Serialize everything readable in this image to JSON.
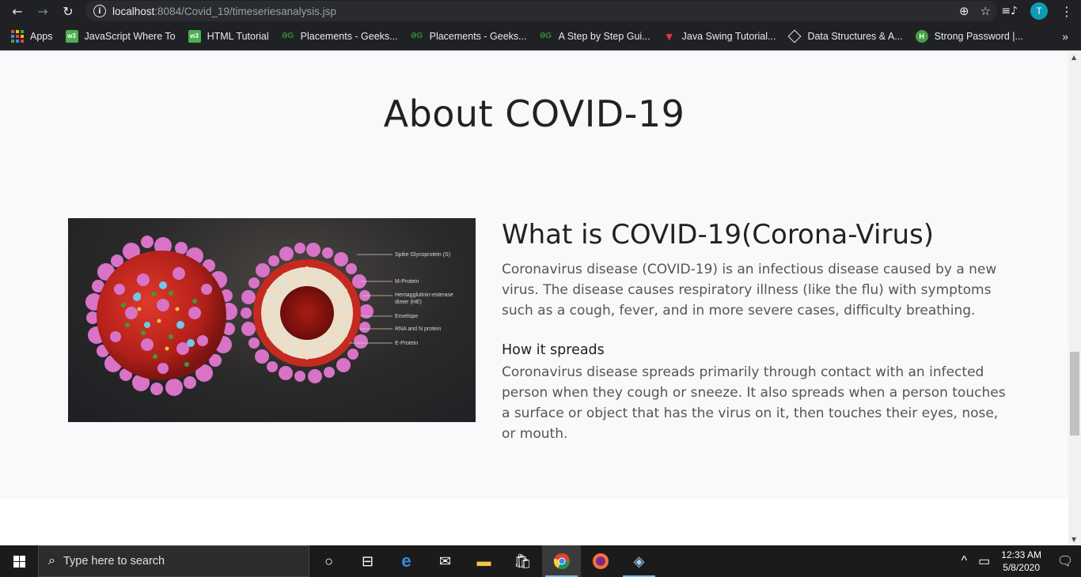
{
  "browser": {
    "url_host": "localhost",
    "url_rest": ":8084/Covid_19/timeseriesanalysis.jsp",
    "avatar_letter": "T"
  },
  "bookmarks": [
    {
      "label": "Apps",
      "icon": "apps-icon"
    },
    {
      "label": "JavaScript Where To",
      "icon": "w3schools-icon"
    },
    {
      "label": "HTML Tutorial",
      "icon": "w3schools-icon"
    },
    {
      "label": "Placements - Geeks...",
      "icon": "geeksforgeeks-icon"
    },
    {
      "label": "Placements - Geeks...",
      "icon": "geeksforgeeks-icon"
    },
    {
      "label": "A Step by Step Gui...",
      "icon": "geeksforgeeks-icon"
    },
    {
      "label": "Java Swing Tutorial...",
      "icon": "javatpoint-icon"
    },
    {
      "label": "Data Structures & A...",
      "icon": "diamond-icon"
    },
    {
      "label": "Strong Password |...",
      "icon": "h-icon"
    }
  ],
  "page": {
    "heading": "About COVID-19",
    "subheading": "What is COVID-19(Corona-Virus)",
    "paragraph1": "Coronavirus disease (COVID-19) is an infectious disease caused by a new virus. The disease causes respiratory illness (like the flu) with symptoms such as a cough, fever, and in more severe cases, difficulty breathing.",
    "spreads_title": "How it spreads",
    "paragraph2": "Coronavirus disease spreads primarily through contact with an infected person when they cough or sneeze. It also spreads when a person touches a surface or object that has the virus on it, then touches their eyes, nose, or mouth.",
    "image_labels": [
      "Spike Glycoprotein (S)",
      "M-Protein",
      "Hemagglutinin-esterase",
      "dimer (HE)",
      "Envelope",
      "RNA and N protein",
      "E-Protein"
    ]
  },
  "taskbar": {
    "search_placeholder": "Type here to search",
    "time": "12:33 AM",
    "date": "5/8/2020"
  }
}
